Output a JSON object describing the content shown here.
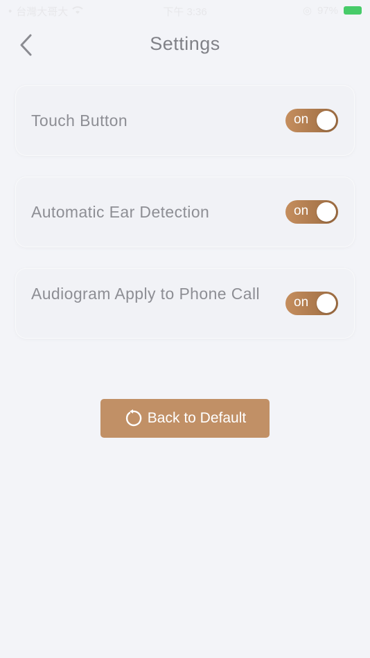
{
  "status_bar": {
    "carrier": "台灣大哥大",
    "time": "下午 3:36",
    "battery": "97%"
  },
  "header": {
    "title": "Settings",
    "back_icon": "chevron-left-icon"
  },
  "settings": [
    {
      "label": "Touch Button",
      "toggle_label": "on",
      "state": true
    },
    {
      "label": "Automatic Ear Detection",
      "toggle_label": "on",
      "state": true
    },
    {
      "label": "Audiogram Apply to Phone Call",
      "toggle_label": "on",
      "state": true
    }
  ],
  "reset": {
    "label": "Back to Default",
    "icon": "reset-icon"
  },
  "colors": {
    "background": "#f3f4f8",
    "accent": "#c19066",
    "toggle_start": "#c58e5e",
    "toggle_end": "#9a6a40",
    "text": "#8d8e94"
  }
}
